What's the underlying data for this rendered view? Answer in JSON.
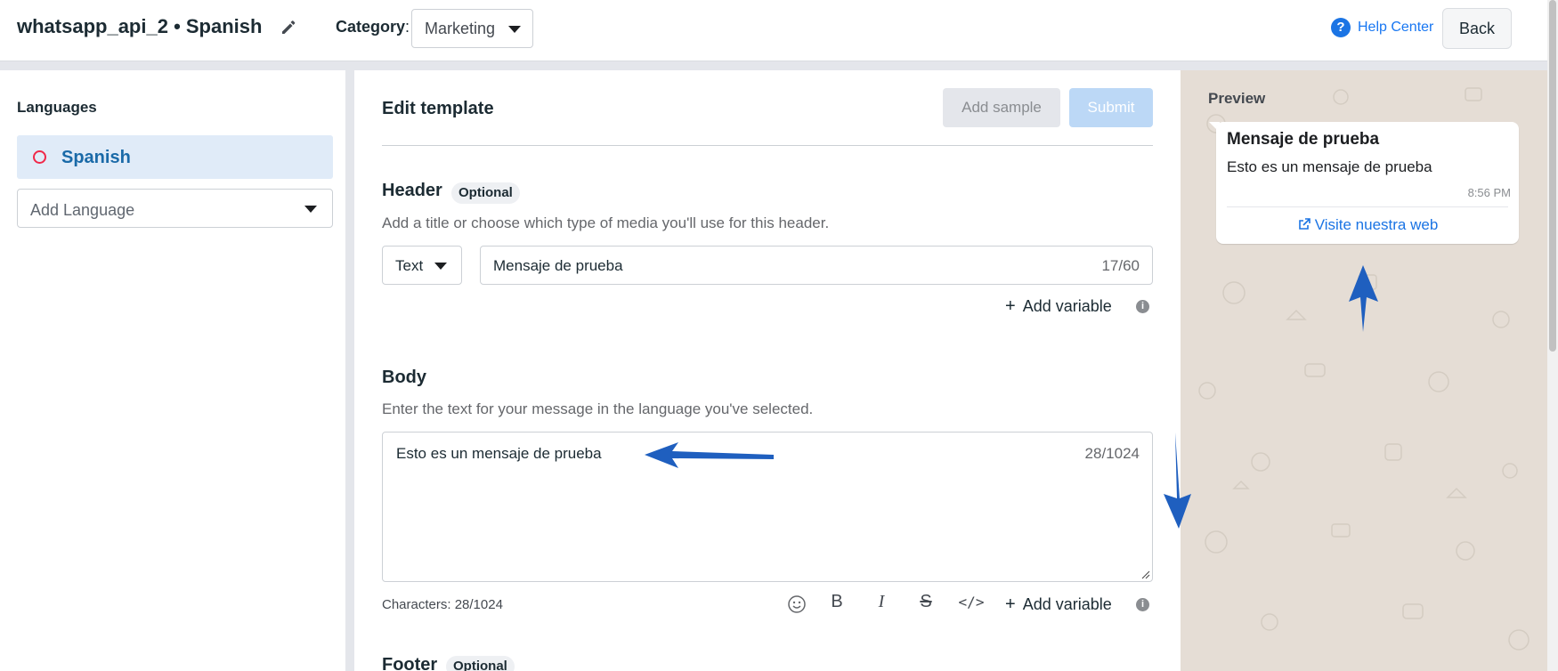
{
  "header": {
    "title": "whatsapp_api_2 • Spanish",
    "category_label": "Category",
    "category_colon": ":",
    "category_value": "Marketing",
    "help_center": "Help Center",
    "back": "Back"
  },
  "sidebar": {
    "title": "Languages",
    "items": [
      {
        "label": "Spanish"
      }
    ],
    "add_language_placeholder": "Add Language"
  },
  "main": {
    "title": "Edit template",
    "add_sample": "Add sample",
    "submit": "Submit",
    "header_section": {
      "title": "Header",
      "badge": "Optional",
      "description": "Add a title or choose which type of media you'll use for this header.",
      "type_value": "Text",
      "input_value": "Mensaje de prueba",
      "counter": "17/60",
      "add_variable": "Add variable"
    },
    "body_section": {
      "title": "Body",
      "description": "Enter the text for your message in the language you've selected.",
      "text": "Esto es un mensaje de prueba",
      "counter": "28/1024",
      "characters": "Characters: 28/1024",
      "bold": "B",
      "italic": "I",
      "strike": "S",
      "code": "</>",
      "add_variable": "Add variable"
    },
    "footer_section": {
      "title": "Footer",
      "badge": "Optional"
    }
  },
  "preview": {
    "title": "Preview",
    "header": "Mensaje de prueba",
    "body": "Esto es un mensaje de prueba",
    "time": "8:56 PM",
    "button": "Visite nuestra web"
  },
  "colors": {
    "accent": "#1877f2",
    "selected_bg": "#e0ebf8",
    "preview_bg": "#e5ddd5",
    "annotation_arrow": "#1f5fbf"
  }
}
